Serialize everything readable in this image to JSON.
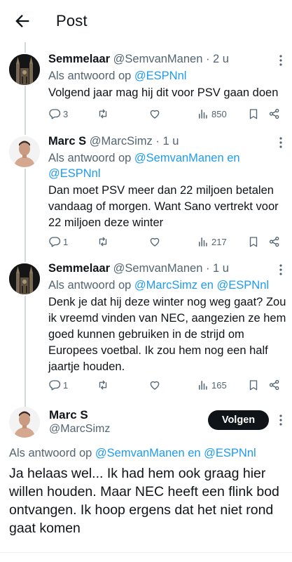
{
  "header": {
    "title": "Post",
    "back_icon": "arrow-left-icon"
  },
  "colors": {
    "link": "#1d9bf0",
    "secondary": "#536471",
    "text": "#0f1419",
    "line": "#cfd9de"
  },
  "replies": [
    {
      "name": "Semmelaar",
      "handle": "@SemvanManen · 2 u",
      "reply_prefix": "Als antwoord op ",
      "reply_targets": "@ESPNnl",
      "text": "Volgend jaar mag hij dit voor PSV gaan doen",
      "stats": {
        "replies": "3",
        "retweets": "",
        "likes": "",
        "views": "850"
      }
    },
    {
      "name": "Marc S",
      "handle": "@MarcSimz · 1 u",
      "reply_prefix": "Als antwoord op ",
      "reply_targets": "@SemvanManen en @ESPNnl",
      "text": "Dan moet PSV meer dan 22 miljoen betalen vandaag of morgen. Want Sano vertrekt voor 22 miljoen deze winter",
      "stats": {
        "replies": "1",
        "retweets": "",
        "likes": "",
        "views": "217"
      }
    },
    {
      "name": "Semmelaar",
      "handle": "@SemvanManen · 1 u",
      "reply_prefix": "Als antwoord op ",
      "reply_targets": "@MarcSimz en @ESPNnl",
      "text": "Denk je dat hij deze winter nog weg gaat? Zou ik vreemd vinden van NEC, aangezien ze hem goed kunnen gebruiken in de strijd om Europees voetbal. Ik zou hem nog een half jaartje houden.",
      "stats": {
        "replies": "1",
        "retweets": "",
        "likes": "",
        "views": "165"
      }
    }
  ],
  "main_post": {
    "name": "Marc S",
    "handle": "@MarcSimz",
    "follow_label": "Volgen",
    "reply_prefix": "Als antwoord op ",
    "reply_targets": "@SemvanManen en @ESPNnl",
    "text": "Ja helaas wel... Ik had hem ook graag hier willen houden. Maar NEC heeft een flink bod ontvangen. Ik hoop ergens dat het niet rond gaat komen"
  }
}
